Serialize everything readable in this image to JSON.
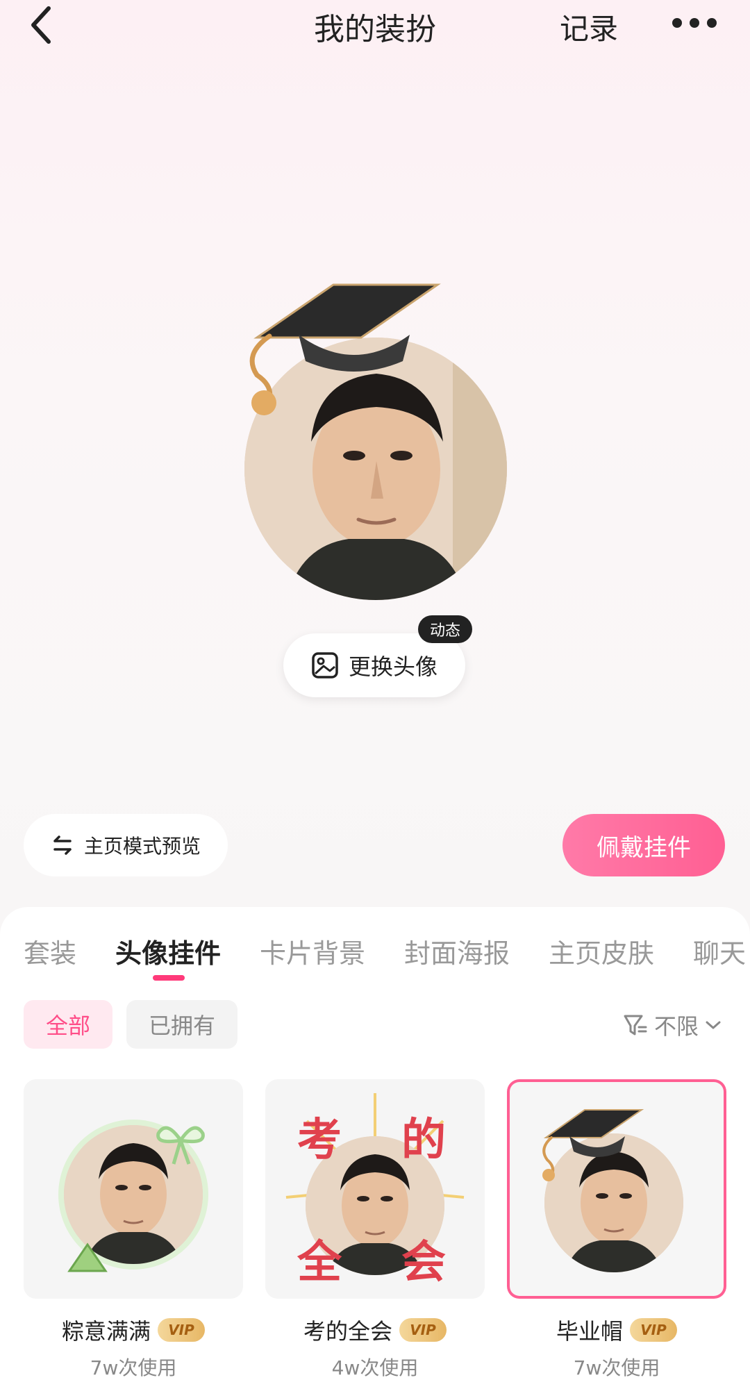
{
  "header": {
    "title": "我的装扮",
    "record_label": "记录"
  },
  "avatar": {
    "change_label": "更换头像",
    "badge_label": "动态"
  },
  "actions": {
    "preview_label": "主页模式预览",
    "wear_label": "佩戴挂件"
  },
  "tabs": [
    {
      "label": "套装"
    },
    {
      "label": "头像挂件"
    },
    {
      "label": "卡片背景"
    },
    {
      "label": "封面海报"
    },
    {
      "label": "主页皮肤"
    },
    {
      "label": "聊天"
    }
  ],
  "filters": {
    "all_label": "全部",
    "owned_label": "已拥有",
    "limit_label": "不限"
  },
  "items": [
    {
      "name": "粽意满满",
      "vip": "VIP",
      "usage": "7w次使用"
    },
    {
      "name": "考的全会",
      "vip": "VIP",
      "usage": "4w次使用",
      "overlay": [
        "考",
        "的",
        "全",
        "会"
      ]
    },
    {
      "name": "毕业帽",
      "vip": "VIP",
      "usage": "7w次使用"
    }
  ],
  "colors": {
    "accent": "#ff5f93",
    "vip_gold": "#e7b765"
  }
}
